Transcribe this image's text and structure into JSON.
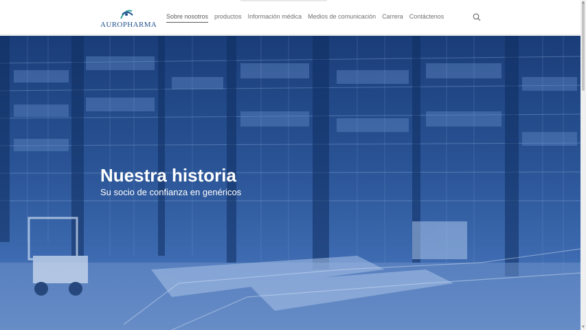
{
  "brand": {
    "name": "AUROPHARMA"
  },
  "nav": {
    "items": [
      {
        "label": "Sobre nosotros",
        "active": true
      },
      {
        "label": "productos"
      },
      {
        "label": "Información médica"
      },
      {
        "label": "Medios de comunicación"
      },
      {
        "label": "Carrera"
      },
      {
        "label": "Contáctenos"
      }
    ],
    "search_icon": "search-icon"
  },
  "hero": {
    "title": "Nuestra historia",
    "subtitle": "Su socio de confianza en genéricos"
  },
  "colors": {
    "brand_blue": "#1f4f8c",
    "hero_overlay": "#2a5496",
    "text_light": "#ffffff"
  }
}
